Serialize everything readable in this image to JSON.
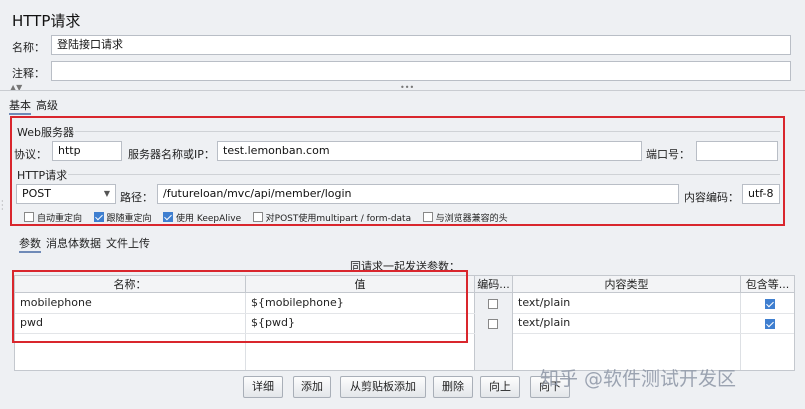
{
  "title": "HTTP请求",
  "name_label": "名称：",
  "name_value": "登陆接口请求",
  "comment_label": "注释：",
  "tabs": [
    "基本",
    "高级"
  ],
  "web_server": {
    "section_label": "Web服务器",
    "protocol_label": "协议：",
    "protocol_value": "http",
    "server_label": "服务器名称或IP：",
    "server_value": "test.lemonban.com",
    "port_label": "端口号："
  },
  "http_request": {
    "section_label": "HTTP请求",
    "method": "POST",
    "path_label": "路径：",
    "path_value": "/futureloan/mvc/api/member/login",
    "encoding_label": "内容编码：",
    "encoding_value": "utf-8",
    "options": [
      {
        "label": "自动重定向",
        "checked": false
      },
      {
        "label": "跟随重定向",
        "checked": true
      },
      {
        "label": "使用 KeepAlive",
        "checked": true
      },
      {
        "label": "对POST使用multipart / form-data",
        "checked": false
      },
      {
        "label": "与浏览器兼容的头",
        "checked": false
      }
    ]
  },
  "sub_tabs": [
    "参数",
    "消息体数据",
    "文件上传"
  ],
  "params_caption": "同请求一起发送参数：",
  "table": {
    "headers": [
      "名称：",
      "值",
      "编码...",
      "内容类型",
      "包含等..."
    ],
    "rows": [
      {
        "name": "mobilephone",
        "value": "${mobilephone}",
        "encode": false,
        "content_type": "text/plain",
        "include_equals": true
      },
      {
        "name": "pwd",
        "value": "${pwd}",
        "encode": false,
        "content_type": "text/plain",
        "include_equals": true
      }
    ]
  },
  "buttons": [
    "详细",
    "添加",
    "从剪贴板添加",
    "删除",
    "向上",
    "向下"
  ],
  "watermark": "知乎 @软件测试开发区",
  "colors": {
    "highlight_border": "#d9262d",
    "checkbox_on": "#3f7fd0"
  }
}
